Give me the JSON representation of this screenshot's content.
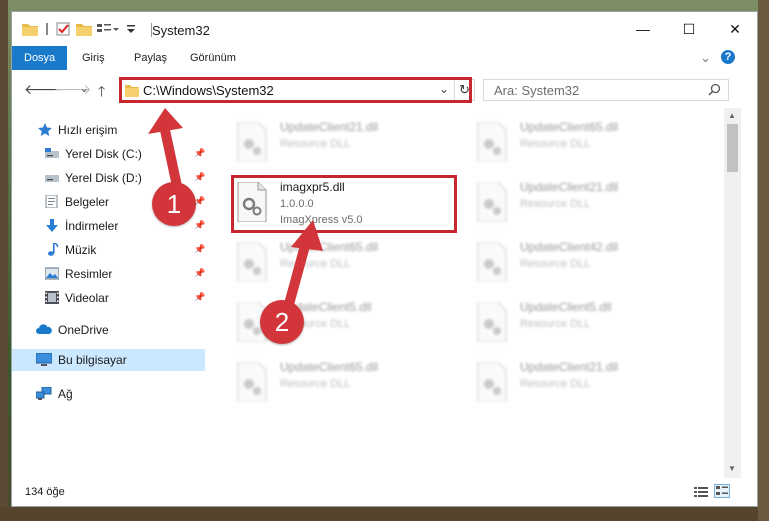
{
  "window": {
    "title": "System32",
    "controls": {
      "minimize": "—",
      "maximize": "☐",
      "close": "✕"
    }
  },
  "ribbon": {
    "tabs": [
      "Dosya",
      "Giriş",
      "Paylaş",
      "Görünüm"
    ],
    "active_tab": "Dosya",
    "collapse": "⌄",
    "help": "?"
  },
  "address": {
    "path": "C:\\Windows\\System32",
    "search_placeholder": "Ara: System32"
  },
  "sidebar": {
    "items": [
      {
        "label": "Hızlı erişim",
        "icon": "star-icon",
        "pinned": false
      },
      {
        "label": "Yerel Disk (C:)",
        "icon": "drive-icon",
        "pinned": true
      },
      {
        "label": "Yerel Disk (D:)",
        "icon": "drive-icon",
        "pinned": true
      },
      {
        "label": "Belgeler",
        "icon": "documents-icon",
        "pinned": true
      },
      {
        "label": "İndirmeler",
        "icon": "download-icon",
        "pinned": true
      },
      {
        "label": "Müzik",
        "icon": "music-icon",
        "pinned": true
      },
      {
        "label": "Resimler",
        "icon": "pictures-icon",
        "pinned": true
      },
      {
        "label": "Videolar",
        "icon": "video-icon",
        "pinned": true
      },
      {
        "label": "OneDrive",
        "icon": "onedrive-icon",
        "pinned": false
      },
      {
        "label": "Bu bilgisayar",
        "icon": "this-pc-icon",
        "pinned": false
      },
      {
        "label": "Ağ",
        "icon": "network-icon",
        "pinned": false
      }
    ],
    "selected": "Bu bilgisayar"
  },
  "files": [
    {
      "name": "UpdateClient21.dll",
      "desc": "Resource DLL"
    },
    {
      "name": "UpdateClient65.dll",
      "desc": "Resource DLL"
    },
    {
      "name": "imagxpr5.dll",
      "desc": "1.0.0.0",
      "desc2": "ImagXpress v5.0",
      "highlighted": true
    },
    {
      "name": "UpdateClient21.dll",
      "desc": "Resource DLL"
    },
    {
      "name": "UpdateClient65.dll",
      "desc": "Resource DLL"
    },
    {
      "name": "UpdateClient42.dll",
      "desc": "Resource DLL"
    },
    {
      "name": "UpdateClient5.dll",
      "desc": "Resource DLL"
    },
    {
      "name": "UpdateClient5.dll",
      "desc": "Resource DLL"
    },
    {
      "name": "UpdateClient65.dll",
      "desc": "Resource DLL"
    },
    {
      "name": "UpdateClient21.dll",
      "desc": "Resource DLL"
    }
  ],
  "status": {
    "item_count": "134 öğe"
  },
  "markers": {
    "one": "1",
    "two": "2"
  },
  "colors": {
    "accent": "#1979ca",
    "highlight": "#c8262e",
    "selected_bg": "#cce8ff"
  }
}
